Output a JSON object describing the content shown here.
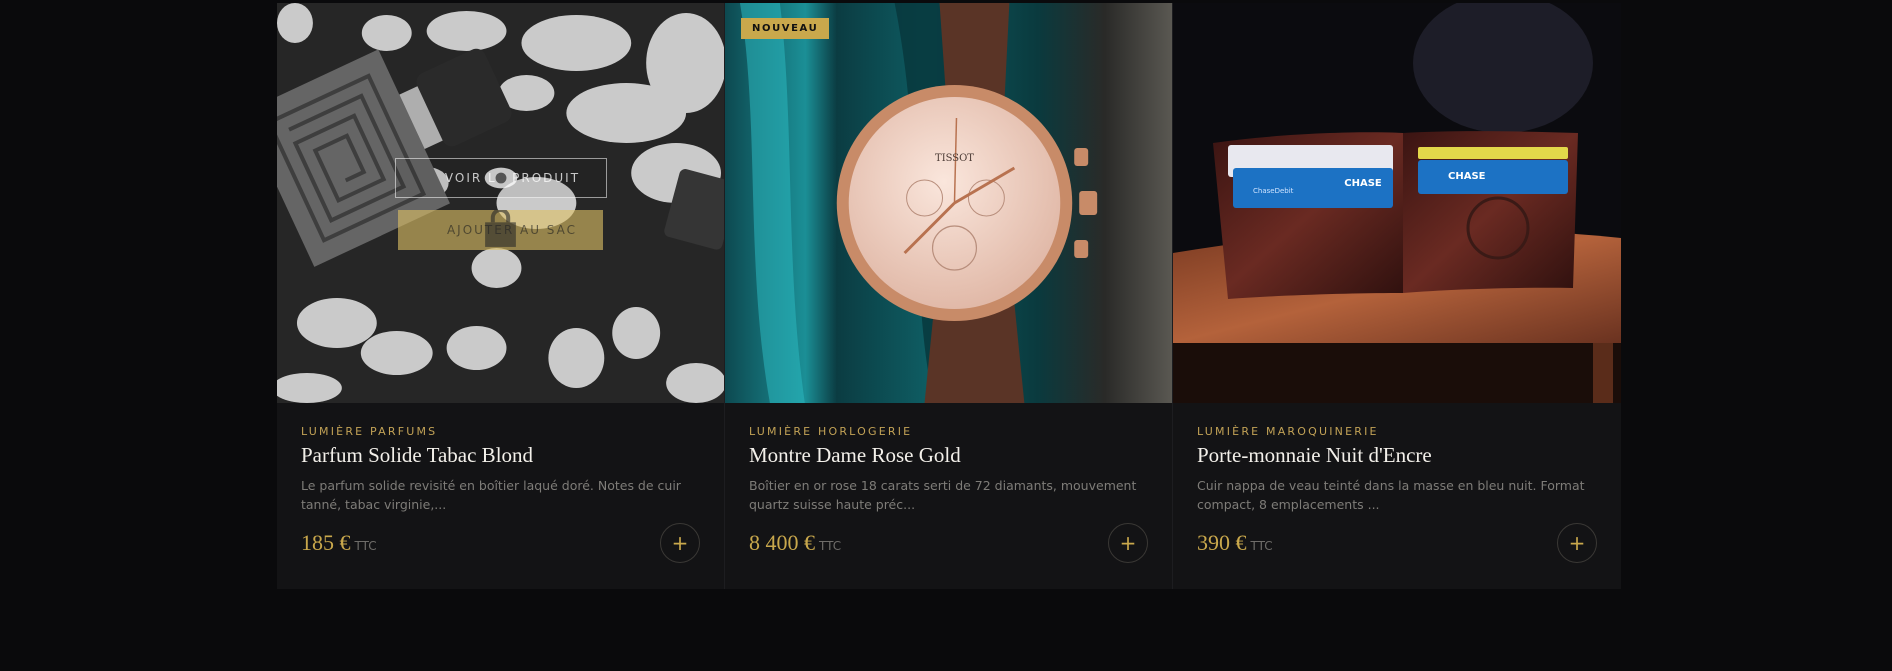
{
  "products": [
    {
      "brand": "LUMIÈRE PARFUMS",
      "name": "Parfum Solide Tabac Blond",
      "description": "Le parfum solide revisité en boîtier laqué doré. Notes de cuir tanné, tabac virginie,...",
      "price": "185 €",
      "price_suffix": "TTC",
      "hover_view_label": "VOIR LE PRODUIT",
      "hover_bag_label": "AJOUTER AU SAC",
      "add_label": "+"
    },
    {
      "badge": "NOUVEAU",
      "brand": "LUMIÈRE HORLOGERIE",
      "name": "Montre Dame Rose Gold",
      "description": "Boîtier en or rose 18 carats serti de 72 diamants, mouvement quartz suisse haute préc...",
      "price": "8 400 €",
      "price_suffix": "TTC",
      "watch_brand_text": "TISSOT",
      "add_label": "+"
    },
    {
      "brand": "LUMIÈRE MAROQUINERIE",
      "name": "Porte-monnaie Nuit d'Encre",
      "description": "Cuir nappa de veau teinté dans la masse en bleu nuit. Format compact, 8 emplacements ...",
      "price": "390 €",
      "price_suffix": "TTC",
      "card_text_1": "CHASE",
      "card_text_2": "CHASE",
      "card_text_3": "ChaseDebit",
      "add_label": "+"
    }
  ],
  "colors": {
    "background": "#0a0a0c",
    "card": "#131315",
    "gold": "#c9a84c",
    "text": "#f3f0ea",
    "muted": "#7e7c78"
  },
  "icons": [
    "eye-icon",
    "bag-icon",
    "plus-icon"
  ]
}
